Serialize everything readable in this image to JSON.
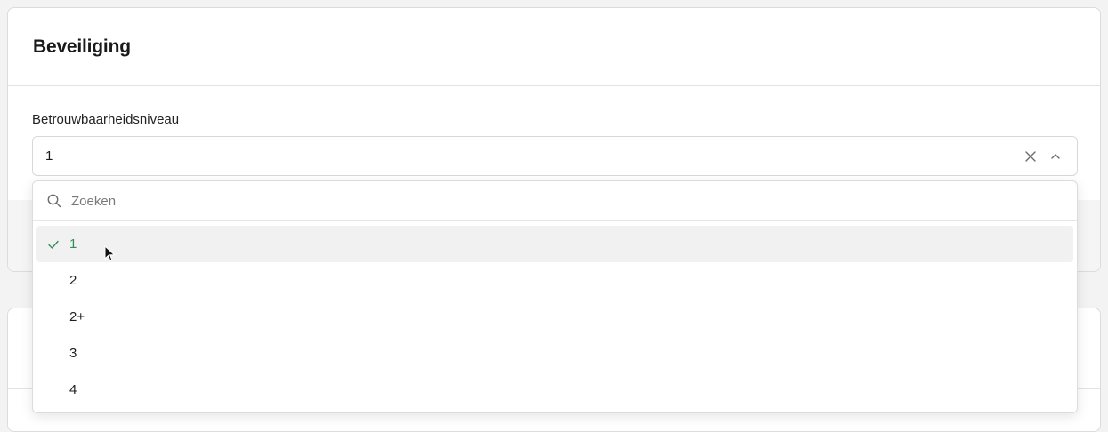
{
  "section": {
    "title": "Beveiliging"
  },
  "field": {
    "label": "Betrouwbaarheidsniveau",
    "value": "1"
  },
  "dropdown": {
    "search_placeholder": "Zoeken",
    "options": [
      {
        "label": "1",
        "selected": true
      },
      {
        "label": "2",
        "selected": false
      },
      {
        "label": "2+",
        "selected": false
      },
      {
        "label": "3",
        "selected": false
      },
      {
        "label": "4",
        "selected": false
      }
    ]
  },
  "colors": {
    "selected_text": "#2f8f5b",
    "selected_bg": "#f1f1f1",
    "border": "#dcdcdc"
  },
  "icons": {
    "clear": "close-icon",
    "toggle": "chevron-up-icon",
    "search": "search-icon",
    "selected": "check-icon"
  }
}
